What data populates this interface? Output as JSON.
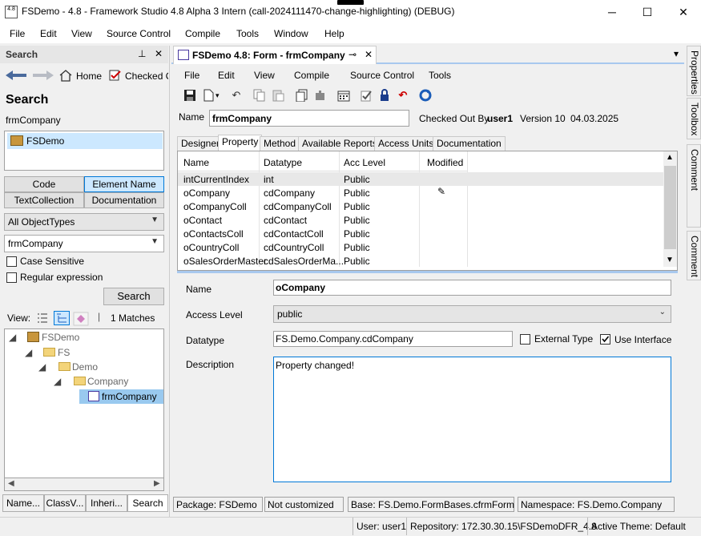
{
  "window": {
    "title": "FSDemo - 4.8 - Framework Studio 4.8 Alpha 3 Intern (call-2024111470-change-highlighting) (DEBUG)",
    "icon_label": "4.8",
    "minimize": "─",
    "maximize": "☐",
    "close": "✕"
  },
  "menu": [
    "File",
    "Edit",
    "View",
    "Source Control",
    "Compile",
    "Tools",
    "Window",
    "Help"
  ],
  "search_panel": {
    "header": "Search",
    "pin": "⊥",
    "close": "✕",
    "home_label": "Home",
    "checked_label": "Checked O",
    "heading": "Search",
    "subheading": "frmCompany",
    "scope_item": "FSDemo",
    "scope_buttons": [
      "Code",
      "Element Name",
      "TextCollection",
      "Documentation"
    ],
    "object_types": "All ObjectTypes",
    "search_text": "frmCompany",
    "case_sensitive": "Case Sensitive",
    "regex": "Regular expression",
    "search_button": "Search",
    "view_label": "View:",
    "matches": "1 Matches",
    "tree": [
      "FSDemo",
      "FS",
      "Demo",
      "Company",
      "frmCompany"
    ],
    "bottom_tabs": [
      "Name...",
      "ClassV...",
      "Inheri...",
      "Search"
    ]
  },
  "doc": {
    "tab_title": "FSDemo 4.8: Form - frmCompany",
    "tab_pin": "⊸",
    "tab_close": "✕",
    "overflow": "▾",
    "menu": [
      "File",
      "Edit",
      "View",
      "Compile",
      "Source Control",
      "Tools"
    ],
    "name_label": "Name",
    "name_value": "frmCompany",
    "checked_out_label": "Checked Out By",
    "checked_out_user": "user1",
    "version": "Version 10",
    "date": "04.03.2025",
    "tabs": [
      "Designer",
      "Property",
      "Method",
      "Available Reports",
      "Access Units",
      "Documentation"
    ],
    "grid": {
      "columns": [
        "Name",
        "Datatype",
        "Acc Level",
        "Modified"
      ],
      "rows": [
        [
          "intCurrentIndex",
          "int",
          "Public",
          ""
        ],
        [
          "oCompany",
          "cdCompany",
          "Public",
          "✎"
        ],
        [
          "oCompanyColl",
          "cdCompanyColl",
          "Public",
          ""
        ],
        [
          "oContact",
          "cdContact",
          "Public",
          ""
        ],
        [
          "oContactsColl",
          "cdContactColl",
          "Public",
          ""
        ],
        [
          "oCountryColl",
          "cdCountryColl",
          "Public",
          ""
        ],
        [
          "oSalesOrderMaster",
          "cdSalesOrderMa...",
          "Public",
          ""
        ]
      ]
    },
    "detail": {
      "name_label": "Name",
      "name_value": "oCompany",
      "access_label": "Access Level",
      "access_value": "public",
      "datatype_label": "Datatype",
      "datatype_value": "FS.Demo.Company.cdCompany",
      "external_type": "External Type",
      "use_interface": "Use Interface",
      "description_label": "Description",
      "description_value": "Property changed!"
    },
    "status": [
      "Package: FSDemo",
      "Not customized",
      "Base: FS.Demo.FormBases.cfrmForm",
      "Namespace: FS.Demo.Company"
    ]
  },
  "right_tabs": [
    "Properties",
    "Toolbox",
    "Check In Comment",
    "Comment"
  ],
  "statusbar": {
    "user": "User: user1",
    "repository": "Repository: 172.30.30.15\\FSDemoDFR_4.8",
    "theme": "Active Theme: Default"
  },
  "colors": {
    "selection": "#cce8ff",
    "tree_selection": "#99c9ef",
    "accent": "#0078d7"
  }
}
